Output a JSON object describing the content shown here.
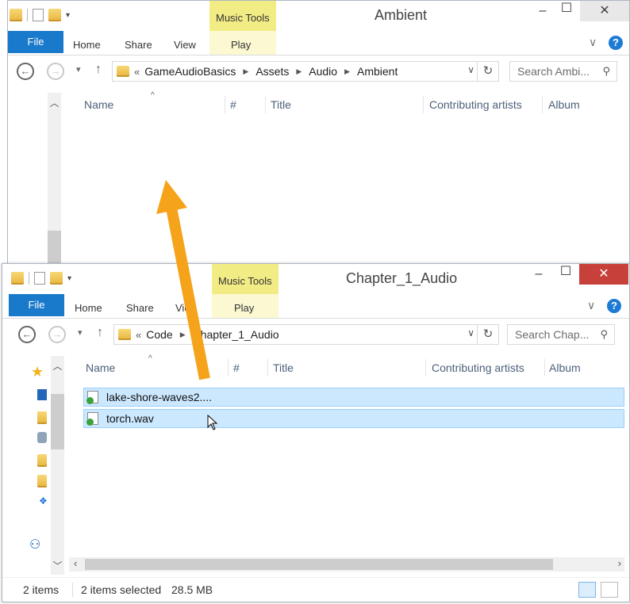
{
  "ambient_window": {
    "title": "Ambient",
    "contextual_tab": "Music Tools",
    "tabs": {
      "file": "File",
      "home": "Home",
      "share": "Share",
      "view": "View",
      "play": "Play"
    },
    "address": {
      "overflow": "«",
      "crumbs": [
        "GameAudioBasics",
        "Assets",
        "Audio",
        "Ambient"
      ]
    },
    "search_placeholder": "Search Ambi...",
    "columns": [
      "Name",
      "#",
      "Title",
      "Contributing artists",
      "Album"
    ]
  },
  "chapter_window": {
    "title": "Chapter_1_Audio",
    "contextual_tab": "Music Tools",
    "tabs": {
      "file": "File",
      "home": "Home",
      "share": "Share",
      "view": "Vie",
      "play": "Play"
    },
    "address": {
      "overflow": "«",
      "crumbs": [
        "Code",
        "Chapter_1_Audio"
      ]
    },
    "search_placeholder": "Search Chap...",
    "columns": [
      "Name",
      "#",
      "Title",
      "Contributing artists",
      "Album"
    ],
    "files": [
      "lake-shore-waves2....",
      "torch.wav"
    ],
    "status": {
      "items": "2 items",
      "selected": "2 items selected",
      "size": "28.5 MB"
    }
  },
  "annotation": {
    "arrow_color": "#f5a31a"
  }
}
